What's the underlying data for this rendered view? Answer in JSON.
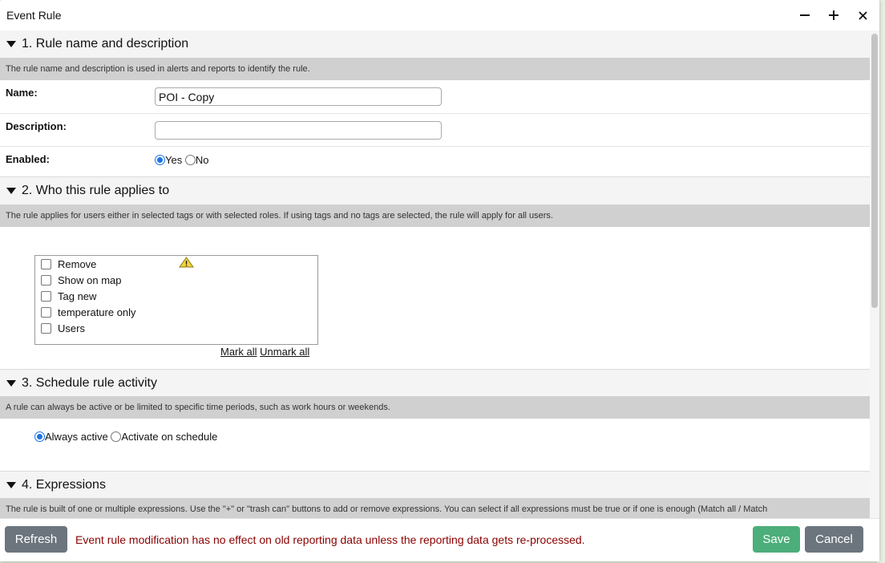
{
  "window": {
    "title": "Event Rule"
  },
  "titlebar": {
    "minimize_icon": "minus-icon",
    "maximize_icon": "plus-icon",
    "close_icon": "close-icon"
  },
  "sections": {
    "s1": {
      "title": "1. Rule name and description",
      "desc": "The rule name and description is used in alerts and reports to identify the rule.",
      "name_label": "Name:",
      "name_value": "POI - Copy",
      "description_label": "Description:",
      "description_value": "",
      "enabled_label": "Enabled:",
      "yes_label": "Yes",
      "no_label": "No",
      "enabled_selected": "Yes"
    },
    "s2": {
      "title": "2. Who this rule applies to",
      "desc": "The rule applies for users either in selected tags or with selected roles. If using tags and no tags are selected, the rule will apply for all users.",
      "tags": [
        "Remove",
        "Show on map",
        "Tag new",
        "temperature only",
        "Users"
      ],
      "mark_all": "Mark all",
      "unmark_all": "Unmark all"
    },
    "s3": {
      "title": "3. Schedule rule activity",
      "desc": "A rule can always be active or be limited to specific time periods, such as work hours or weekends.",
      "always_label": "Always active",
      "schedule_label": "Activate on schedule",
      "selected": "Always active"
    },
    "s4": {
      "title": "4. Expressions",
      "desc": "The rule is built of one or multiple expressions. Use the \"+\" or \"trash can\" buttons to add or remove expressions. You can select if all expressions must be true or if one is enough (Match all / Match"
    }
  },
  "footer": {
    "refresh": "Refresh",
    "warning": "Event rule modification has no effect on old reporting data unless the reporting data gets re-processed.",
    "save": "Save",
    "cancel": "Cancel"
  },
  "colors": {
    "save": "#4cae7a",
    "secondary": "#6c757d",
    "warning_text": "#8b0000",
    "radio_accent": "#1a73e8"
  }
}
